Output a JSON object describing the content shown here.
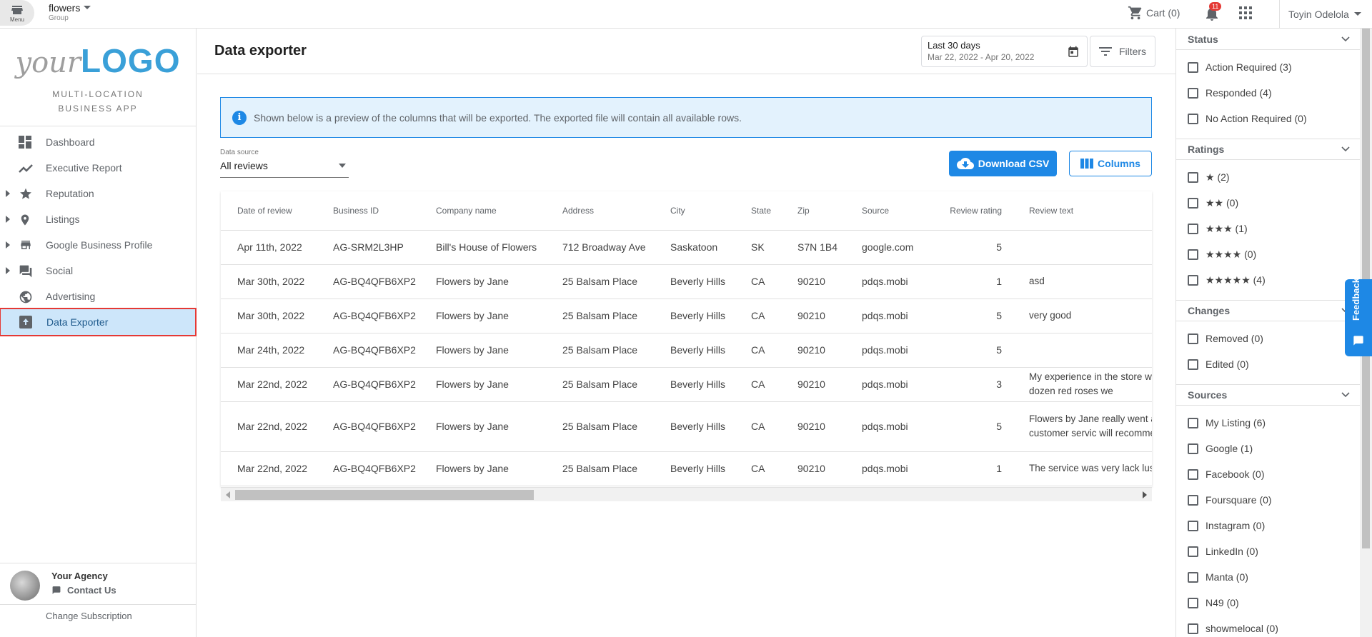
{
  "topbar": {
    "menu_label": "Menu",
    "group_name": "flowers",
    "group_sub": "Group",
    "cart_label": "Cart (0)",
    "notification_count": "11",
    "user_name": "Toyin Odelola"
  },
  "sidebar": {
    "logo_your": "your",
    "logo_big": "LOGO",
    "app_line1": "MULTI-LOCATION",
    "app_line2": "BUSINESS APP",
    "items": [
      {
        "label": "Dashboard",
        "icon": "dashboard-icon",
        "expandable": false
      },
      {
        "label": "Executive Report",
        "icon": "trending-icon",
        "expandable": false
      },
      {
        "label": "Reputation",
        "icon": "star-icon",
        "expandable": true
      },
      {
        "label": "Listings",
        "icon": "location-pin-icon",
        "expandable": true
      },
      {
        "label": "Google Business Profile",
        "icon": "store-icon",
        "expandable": true
      },
      {
        "label": "Social",
        "icon": "chat-icon",
        "expandable": true
      },
      {
        "label": "Advertising",
        "icon": "globe-icon",
        "expandable": false
      },
      {
        "label": "Data Exporter",
        "icon": "export-icon",
        "expandable": false,
        "active": true
      }
    ],
    "agency_name": "Your Agency",
    "contact_label": "Contact Us",
    "change_subscription": "Change Subscription"
  },
  "main": {
    "title": "Data exporter",
    "date_title": "Last 30 days",
    "date_range": "Mar 22, 2022 - Apr 20, 2022",
    "filters_label": "Filters",
    "info_text": "Shown below is a preview of the columns that will be exported. The exported file will contain all available rows.",
    "data_source_label": "Data source",
    "data_source_value": "All reviews",
    "download_label": "Download CSV",
    "columns_label": "Columns"
  },
  "table": {
    "headers": [
      "Date of review",
      "Business ID",
      "Company name",
      "Address",
      "City",
      "State",
      "Zip",
      "Source",
      "Review rating",
      "Review text"
    ],
    "rows": [
      [
        "Apr 11th, 2022",
        "AG-SRM2L3HP",
        "Bill's House of Flowers",
        "712 Broadway Ave",
        "Saskatoon",
        "SK",
        "S7N 1B4",
        "google.com",
        "5",
        ""
      ],
      [
        "Mar 30th, 2022",
        "AG-BQ4QFB6XP2",
        "Flowers by Jane",
        "25 Balsam Place",
        "Beverly Hills",
        "CA",
        "90210",
        "pdqs.mobi",
        "1",
        "asd"
      ],
      [
        "Mar 30th, 2022",
        "AG-BQ4QFB6XP2",
        "Flowers by Jane",
        "25 Balsam Place",
        "Beverly Hills",
        "CA",
        "90210",
        "pdqs.mobi",
        "5",
        "very good"
      ],
      [
        "Mar 24th, 2022",
        "AG-BQ4QFB6XP2",
        "Flowers by Jane",
        "25 Balsam Place",
        "Beverly Hills",
        "CA",
        "90210",
        "pdqs.mobi",
        "5",
        ""
      ],
      [
        "Mar 22nd, 2022",
        "AG-BQ4QFB6XP2",
        "Flowers by Jane",
        "25 Balsam Place",
        "Beverly Hills",
        "CA",
        "90210",
        "pdqs.mobi",
        "3",
        "My experience in the store was expensive a dozen red roses we"
      ],
      [
        "Mar 22nd, 2022",
        "AG-BQ4QFB6XP2",
        "Flowers by Jane",
        "25 Balsam Place",
        "Beverly Hills",
        "CA",
        "90210",
        "pdqs.mobi",
        "5",
        "Flowers by Jane really went abo expected good customer servic will recommend Flowers by Jan"
      ],
      [
        "Mar 22nd, 2022",
        "AG-BQ4QFB6XP2",
        "Flowers by Jane",
        "25 Balsam Place",
        "Beverly Hills",
        "CA",
        "90210",
        "pdqs.mobi",
        "1",
        "The service was very lack luste after properly."
      ]
    ]
  },
  "filters": {
    "sections": [
      {
        "title": "Status",
        "options": [
          "Action Required (3)",
          "Responded (4)",
          "No Action Required (0)"
        ]
      },
      {
        "title": "Ratings",
        "options": [
          "★ (2)",
          "★★ (0)",
          "★★★ (1)",
          "★★★★ (0)",
          "★★★★★ (4)"
        ]
      },
      {
        "title": "Changes",
        "options": [
          "Removed (0)",
          "Edited (0)"
        ]
      },
      {
        "title": "Sources",
        "options": [
          "My Listing (6)",
          "Google (1)",
          "Facebook (0)",
          "Foursquare (0)",
          "Instagram (0)",
          "LinkedIn (0)",
          "Manta (0)",
          "N49 (0)",
          "showmelocal (0)"
        ]
      }
    ],
    "feedback_label": "Feedback"
  },
  "colors": {
    "accent": "#1e88e5",
    "active_nav_bg": "#cde6fa",
    "highlight_outline": "#e53935",
    "info_bg": "#e3f2fd",
    "logo_blue": "#3aa0d8"
  }
}
